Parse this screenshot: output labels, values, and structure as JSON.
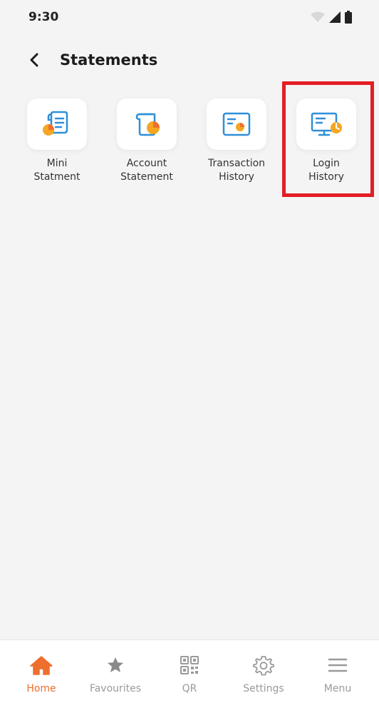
{
  "status_bar": {
    "time": "9:30"
  },
  "header": {
    "title": "Statements"
  },
  "tiles": [
    {
      "label": "Mini\nStatment",
      "icon": "mini-statement-icon"
    },
    {
      "label": "Account\nStatement",
      "icon": "account-statement-icon"
    },
    {
      "label": "Transaction\nHistory",
      "icon": "transaction-history-icon"
    },
    {
      "label": "Login\nHistory",
      "icon": "login-history-icon",
      "highlighted": true
    }
  ],
  "bottom_nav": [
    {
      "label": "Home",
      "icon": "home-icon",
      "active": true
    },
    {
      "label": "Favourites",
      "icon": "star-icon"
    },
    {
      "label": "QR",
      "icon": "qr-icon"
    },
    {
      "label": "Settings",
      "icon": "gear-icon"
    },
    {
      "label": "Menu",
      "icon": "menu-icon"
    }
  ],
  "colors": {
    "accent": "#ee6f2d",
    "icon_blue": "#2f8fd8",
    "highlight": "#e41d25",
    "background": "#f4f4f4"
  }
}
